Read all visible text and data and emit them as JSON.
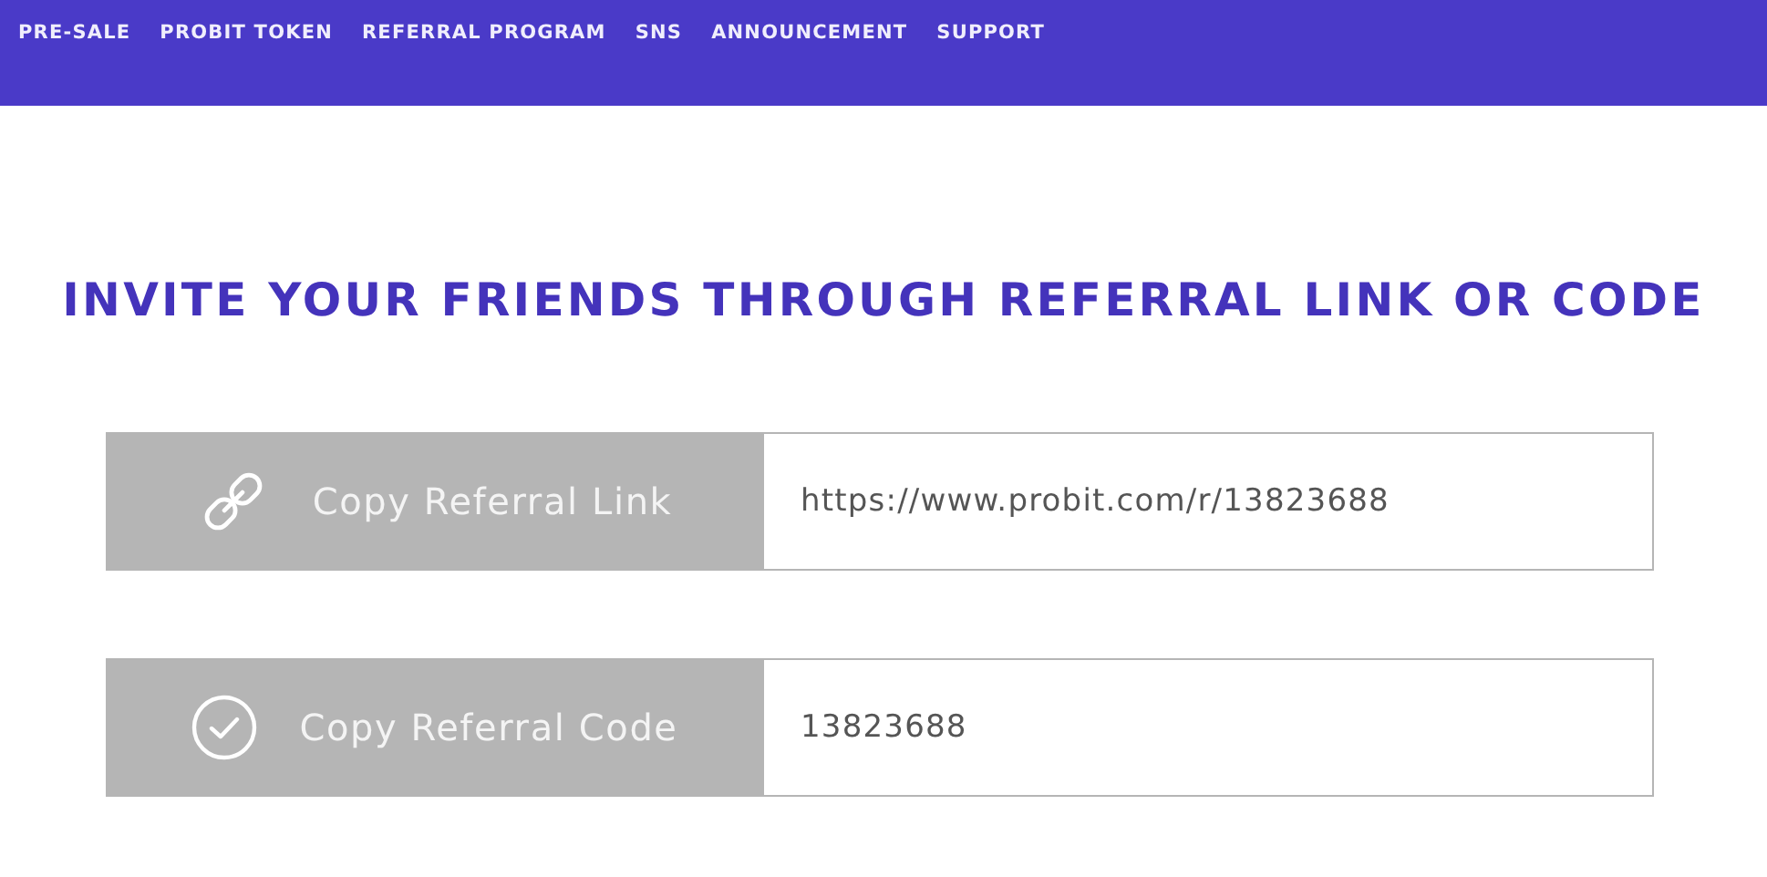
{
  "nav": {
    "items": [
      {
        "label": "PRE-SALE"
      },
      {
        "label": "PROBIT TOKEN"
      },
      {
        "label": "REFERRAL PROGRAM"
      },
      {
        "label": "SNS"
      },
      {
        "label": "ANNOUNCEMENT"
      },
      {
        "label": "SUPPORT"
      }
    ]
  },
  "heading": "INVITE YOUR FRIENDS THROUGH REFERRAL LINK OR CODE",
  "rows": [
    {
      "kind": "link",
      "button": "Copy Referral Link",
      "value": "https://www.probit.com/r/13823688"
    },
    {
      "kind": "check",
      "button": "Copy Referral Code",
      "value": "13823688"
    }
  ]
}
